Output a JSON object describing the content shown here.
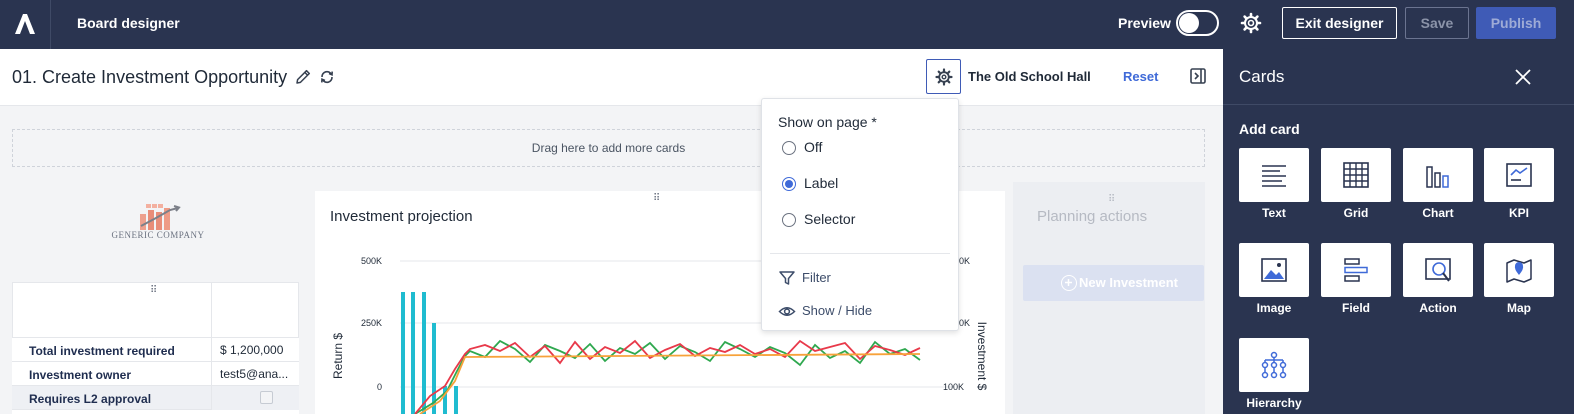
{
  "topbar": {
    "app_title": "Board designer",
    "preview_label": "Preview",
    "exit_label": "Exit designer",
    "save_label": "Save",
    "publish_label": "Publish"
  },
  "page": {
    "title": "01. Create Investment Opportunity",
    "location": "The Old School Hall",
    "reset_label": "Reset",
    "dropzone_text": "Drag here to add more cards"
  },
  "logo_card": {
    "company_name": "GENERIC COMPANY"
  },
  "grid_card": {
    "rows": [
      {
        "label": "Total investment required",
        "value": "$ 1,200,000"
      },
      {
        "label": "Investment owner",
        "value": "test5@ana..."
      },
      {
        "label": "Requires L2 approval",
        "value": ""
      }
    ]
  },
  "chart_card": {
    "title": "Investment projection"
  },
  "chart_data": {
    "type": "bar",
    "title": "Investment projection",
    "ylabel": "Return $",
    "y2label": "Investment $",
    "y_ticks": [
      "500K",
      "250K",
      "0"
    ],
    "y2_ticks": [
      "0K",
      "0K",
      "100K"
    ],
    "series": [
      {
        "name": "",
        "color": "#1fbcd0"
      },
      {
        "name": "",
        "color": "#e8394a"
      },
      {
        "name": "",
        "color": "#2fa84f"
      },
      {
        "name": "",
        "color": "#f7a23a"
      }
    ]
  },
  "actions_card": {
    "title": "Planning actions",
    "new_button": "New Investment"
  },
  "popover": {
    "label": "Show on page *",
    "options": [
      "Off",
      "Label",
      "Selector"
    ],
    "selected": "Label",
    "filter_label": "Filter",
    "showhide_label": "Show / Hide"
  },
  "panel": {
    "title": "Cards",
    "add_card_label": "Add card",
    "tiles": [
      "Text",
      "Grid",
      "Chart",
      "KPI",
      "Image",
      "Field",
      "Action",
      "Map",
      "Hierarchy"
    ]
  },
  "colors": {
    "navy": "#2a3450",
    "accent": "#3f6ad8",
    "publish": "#3f5bb6"
  }
}
